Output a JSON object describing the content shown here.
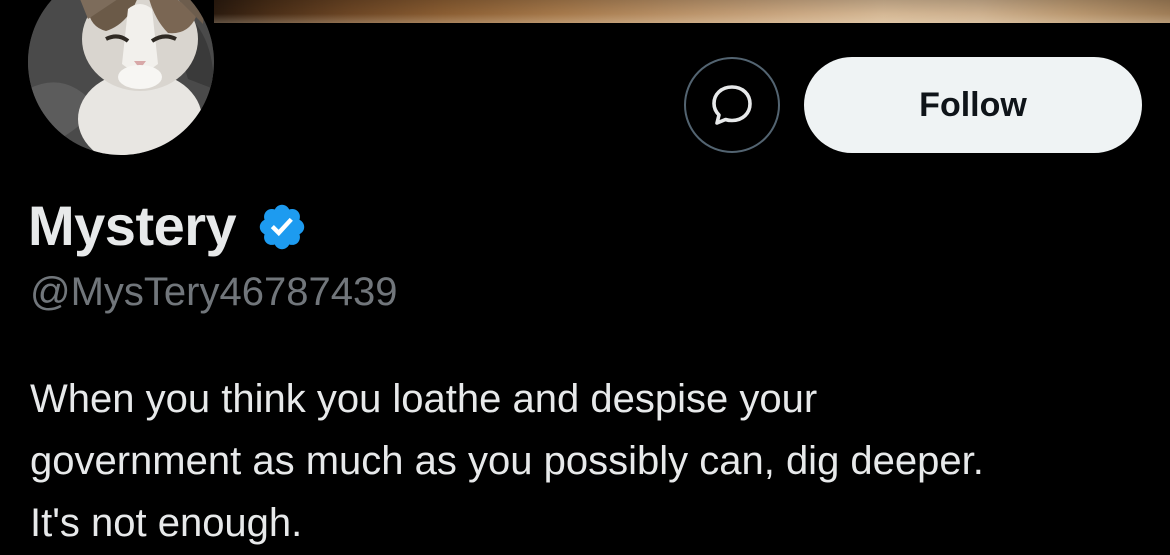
{
  "profile": {
    "display_name": "Mystery",
    "handle": "@MysTery46787439",
    "verified_icon": "verified-badge-icon",
    "bio_lines": [
      "When you think you loathe and despise your",
      "government as much as you possibly can, dig deeper.",
      "It's not enough."
    ]
  },
  "actions": {
    "message_icon": "message-bubble-icon",
    "follow_label": "Follow"
  },
  "colors": {
    "background": "#000000",
    "primary_text": "#e7e9ea",
    "secondary_text": "#71767b",
    "verified_blue": "#1d9bf0",
    "follow_button_bg": "#eff3f4",
    "button_border": "#536471"
  }
}
